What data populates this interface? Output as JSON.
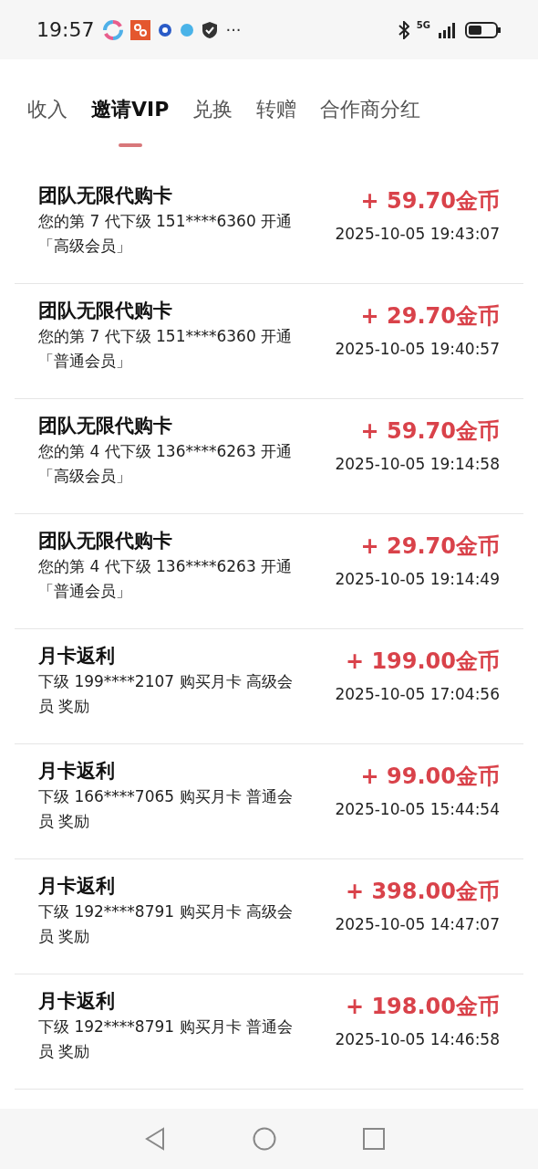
{
  "status_bar": {
    "time": "19:57",
    "more": "···",
    "network": "5G"
  },
  "tabs": [
    {
      "label": "收入",
      "selected": false
    },
    {
      "label": "邀请VIP",
      "selected": true
    },
    {
      "label": "兑换",
      "selected": false
    },
    {
      "label": "转赠",
      "selected": false
    },
    {
      "label": "合作商分红",
      "selected": false
    }
  ],
  "records": [
    {
      "title": "团队无限代购卡",
      "description": "您的第 7 代下级 151****6360 开通「高级会员」",
      "amount": "+ 59.70金币",
      "time": "2025-10-05 19:43:07"
    },
    {
      "title": "团队无限代购卡",
      "description": "您的第 7 代下级 151****6360 开通「普通会员」",
      "amount": "+ 29.70金币",
      "time": "2025-10-05 19:40:57"
    },
    {
      "title": "团队无限代购卡",
      "description": "您的第 4 代下级 136****6263 开通「高级会员」",
      "amount": "+ 59.70金币",
      "time": "2025-10-05 19:14:58"
    },
    {
      "title": "团队无限代购卡",
      "description": "您的第 4 代下级 136****6263 开通「普通会员」",
      "amount": "+ 29.70金币",
      "time": "2025-10-05 19:14:49"
    },
    {
      "title": "月卡返利",
      "description": "下级 199****2107 购买月卡 高级会员 奖励",
      "amount": "+ 199.00金币",
      "time": "2025-10-05 17:04:56"
    },
    {
      "title": "月卡返利",
      "description": "下级 166****7065 购买月卡 普通会员 奖励",
      "amount": "+ 99.00金币",
      "time": "2025-10-05 15:44:54"
    },
    {
      "title": "月卡返利",
      "description": "下级 192****8791 购买月卡 高级会员 奖励",
      "amount": "+ 398.00金币",
      "time": "2025-10-05 14:47:07"
    },
    {
      "title": "月卡返利",
      "description": "下级 192****8791 购买月卡 普通会员 奖励",
      "amount": "+ 198.00金币",
      "time": "2025-10-05 14:46:58"
    }
  ]
}
